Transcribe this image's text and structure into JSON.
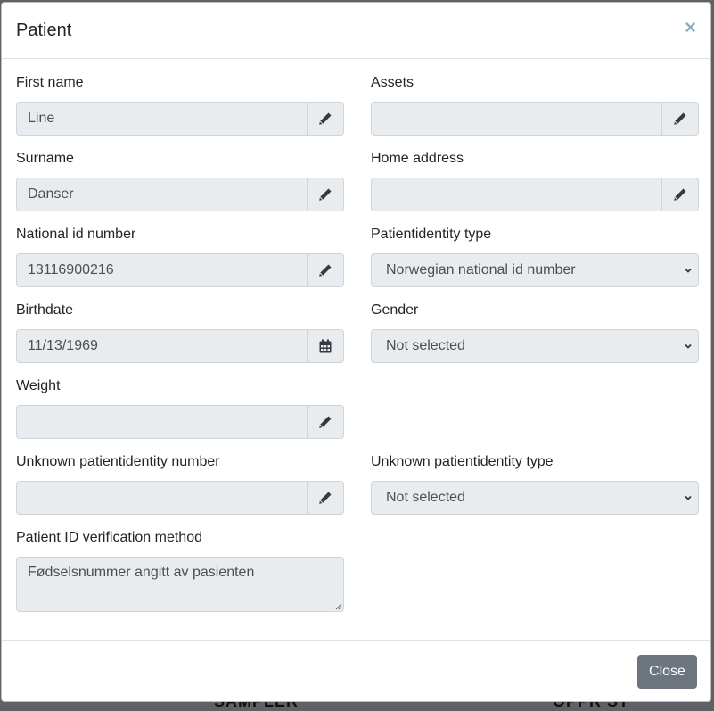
{
  "backdrop": {
    "left_text": "SAMPLER",
    "right_text": "OPPR ST"
  },
  "modal": {
    "title": "Patient",
    "close_symbol": "×",
    "fields": {
      "first_name": {
        "label": "First name",
        "value": "Line",
        "icon": "pencil-icon"
      },
      "assets": {
        "label": "Assets",
        "value": "",
        "icon": "pencil-icon"
      },
      "surname": {
        "label": "Surname",
        "value": "Danser",
        "icon": "pencil-icon"
      },
      "home_address": {
        "label": "Home address",
        "value": "",
        "icon": "pencil-icon"
      },
      "national_id": {
        "label": "National id number",
        "value": "13116900216",
        "icon": "pencil-icon"
      },
      "identity_type": {
        "label": "Patientidentity type",
        "value": "Norwegian national id number",
        "icon": "chevron-down-icon"
      },
      "birthdate": {
        "label": "Birthdate",
        "value": "11/13/1969",
        "icon": "calendar-icon"
      },
      "gender": {
        "label": "Gender",
        "value": "Not selected",
        "icon": "chevron-down-icon"
      },
      "weight": {
        "label": "Weight",
        "value": "",
        "icon": "pencil-icon"
      },
      "unknown_number": {
        "label": "Unknown patientidentity number",
        "value": "",
        "icon": "pencil-icon"
      },
      "unknown_type": {
        "label": "Unknown patientidentity type",
        "value": "Not selected",
        "icon": "chevron-down-icon"
      },
      "verification": {
        "label": "Patient ID verification method",
        "value": "Fødselsnummer angitt av pasienten"
      }
    },
    "footer": {
      "close_label": "Close"
    }
  },
  "colors": {
    "button_secondary": "#6c757d",
    "input_disabled_bg": "#e9ecef",
    "close_x": "#8aaebf"
  }
}
